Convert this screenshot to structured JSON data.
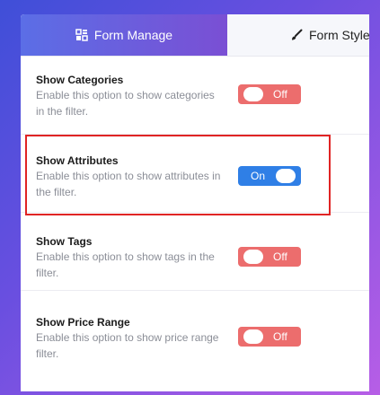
{
  "tabs": [
    {
      "label": "Form Manage",
      "icon": "form-grid-icon",
      "active": true
    },
    {
      "label": "Form Style",
      "icon": "paintbrush-icon",
      "active": false
    }
  ],
  "settings": [
    {
      "title": "Show Categories",
      "description": "Enable this option to show categories in the filter.",
      "toggle": "Off",
      "checked": false
    },
    {
      "title": "Show Attributes",
      "description": "Enable this option to show attributes in the filter.",
      "toggle": "On",
      "checked": true
    },
    {
      "title": "Show Tags",
      "description": "Enable this option to show tags in the filter.",
      "toggle": "Off",
      "checked": false
    },
    {
      "title": "Show Price Range",
      "description": "Enable this option to show price range filter.",
      "toggle": "Off",
      "checked": false
    }
  ],
  "colors": {
    "active_tab_start": "#5b6ee6",
    "active_tab_end": "#7a4fd4",
    "toggle_off": "#ec6d6d",
    "toggle_on": "#2f7fe6",
    "highlight_border": "#e02424"
  }
}
